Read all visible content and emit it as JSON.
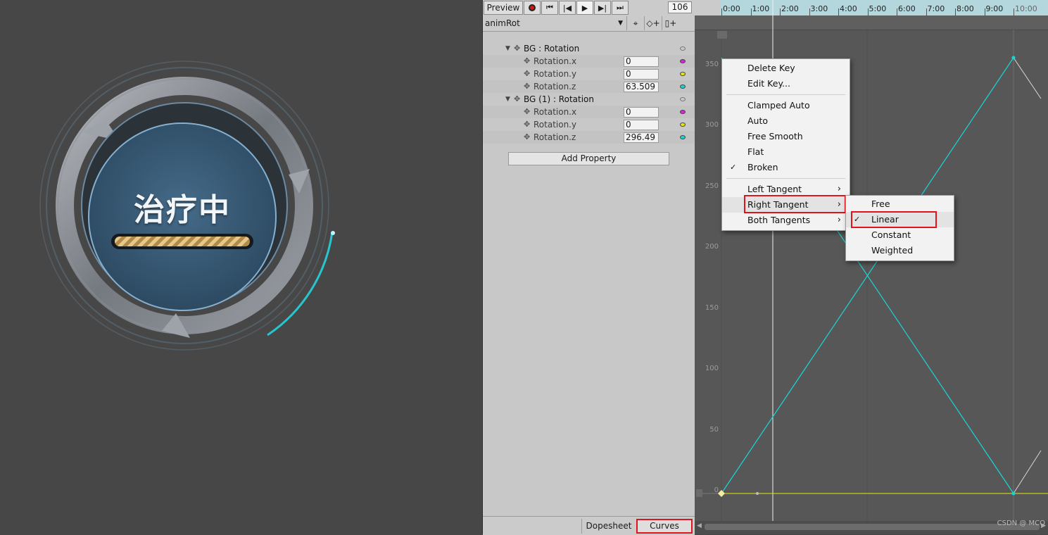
{
  "scene": {
    "treatment_label": "治疗中"
  },
  "animation": {
    "toolbar": {
      "preview_label": "Preview",
      "record_icon": "record-icon",
      "first_icon": "first-key-icon",
      "prev_icon": "prev-key-icon",
      "play_icon": "play-icon",
      "next_icon": "next-key-icon",
      "last_icon": "last-key-icon",
      "frame": "106"
    },
    "clip": {
      "name": "animRot"
    },
    "properties": [
      {
        "label": "BG : Rotation",
        "children": [
          {
            "label": "Rotation.x",
            "value": "0",
            "color": "#e020e0"
          },
          {
            "label": "Rotation.y",
            "value": "0",
            "color": "#e8e800"
          },
          {
            "label": "Rotation.z",
            "value": "63.509",
            "color": "#19d6d6"
          }
        ]
      },
      {
        "label": "BG (1) : Rotation",
        "children": [
          {
            "label": "Rotation.x",
            "value": "0",
            "color": "#e020e0"
          },
          {
            "label": "Rotation.y",
            "value": "0",
            "color": "#e8e800"
          },
          {
            "label": "Rotation.z",
            "value": "296.49",
            "color": "#19d6d6"
          }
        ]
      }
    ],
    "add_property_label": "Add Property",
    "tabs": {
      "dopesheet": "Dopesheet",
      "curves": "Curves"
    }
  },
  "curve_editor": {
    "time_ticks": [
      "0:00",
      "1:00",
      "2:00",
      "3:00",
      "4:00",
      "5:00",
      "6:00",
      "7:00",
      "8:00",
      "9:00",
      "10:00"
    ],
    "y_ticks": [
      "350",
      "300",
      "250",
      "200",
      "150",
      "100",
      "50",
      "0"
    ],
    "watermark": "CSDN @ MCO"
  },
  "context_menu": {
    "items": [
      {
        "label": "Delete Key"
      },
      {
        "label": "Edit Key..."
      },
      {
        "label": "Clamped Auto"
      },
      {
        "label": "Auto"
      },
      {
        "label": "Free Smooth"
      },
      {
        "label": "Flat"
      },
      {
        "label": "Broken",
        "checked": true
      },
      {
        "label": "Left Tangent"
      },
      {
        "label": "Right Tangent"
      },
      {
        "label": "Both Tangents"
      }
    ],
    "submenu": [
      {
        "label": "Free"
      },
      {
        "label": "Linear",
        "checked": true
      },
      {
        "label": "Constant"
      },
      {
        "label": "Weighted"
      }
    ]
  }
}
